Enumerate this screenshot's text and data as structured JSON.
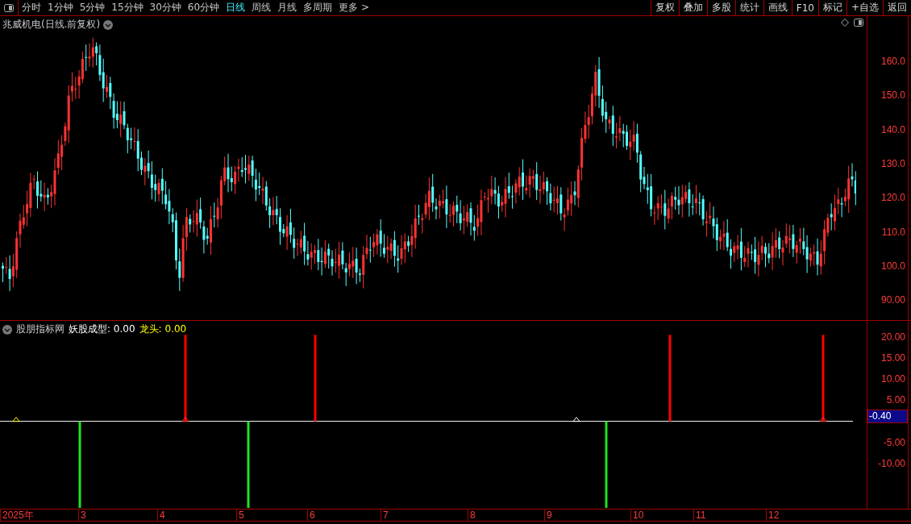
{
  "toolbar": {
    "periods": [
      {
        "label": "分时",
        "selected": false
      },
      {
        "label": "1分钟",
        "selected": false
      },
      {
        "label": "5分钟",
        "selected": false
      },
      {
        "label": "15分钟",
        "selected": false
      },
      {
        "label": "30分钟",
        "selected": false
      },
      {
        "label": "60分钟",
        "selected": false
      },
      {
        "label": "日线",
        "selected": true
      },
      {
        "label": "周线",
        "selected": false
      },
      {
        "label": "月线",
        "selected": false
      },
      {
        "label": "多周期",
        "selected": false
      },
      {
        "label": "更多 >",
        "selected": false
      }
    ],
    "buttons": [
      "复权",
      "叠加",
      "多股",
      "统计",
      "画线",
      "F10",
      "标记",
      "+自选",
      "返回"
    ]
  },
  "main_chart": {
    "title": "兆威机电(日线.前复权)",
    "price_labels": [
      "160.0",
      "150.0",
      "140.0",
      "130.0",
      "120.0",
      "110.0",
      "100.0",
      "90.00"
    ]
  },
  "indicator": {
    "name": "股朋指标网",
    "legend": [
      {
        "label": "妖股成型: 0.00",
        "color": "#ffffff"
      },
      {
        "label": "龙头: 0.00",
        "color": "#ffff00"
      }
    ],
    "axis_labels": [
      "20.00",
      "15.00",
      "10.00",
      "5.00",
      "-5.00",
      "-10.00"
    ],
    "current_value": "-0.40"
  },
  "date_axis": {
    "labels": [
      "2025年",
      "3",
      "4",
      "5",
      "6",
      "7",
      "8",
      "9",
      "10",
      "11",
      "12"
    ]
  }
}
